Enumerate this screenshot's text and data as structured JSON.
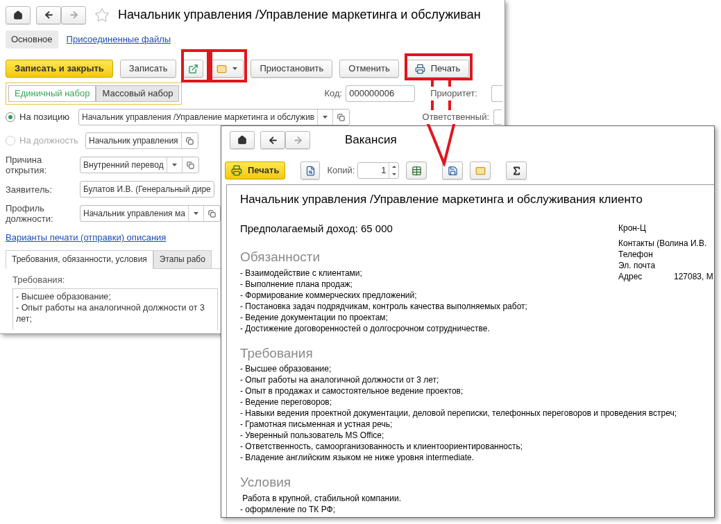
{
  "back_window": {
    "title": "Начальник управления /Управление маркетинга и обслуживан",
    "tabs": [
      {
        "label": "Основное",
        "selected": true
      },
      {
        "label": "Присоединенные файлы",
        "selected": false
      }
    ],
    "toolbar": [
      {
        "kind": "primary",
        "label": "Записать и закрыть"
      },
      {
        "kind": "text",
        "label": "Записать"
      },
      {
        "kind": "external"
      },
      {
        "kind": "mail"
      },
      {
        "kind": "text",
        "label": "Приостановить"
      },
      {
        "kind": "text",
        "label": "Отменить"
      },
      {
        "kind": "print",
        "label": "Печать"
      }
    ],
    "set_modes": [
      {
        "label": "Единичный набор",
        "selected": true
      },
      {
        "label": "Массовый набор",
        "selected": false
      }
    ],
    "code_label": "Код:",
    "code_value": "000000006",
    "priority_label": "Приоритет:",
    "position_modes": [
      {
        "label": "На позицию",
        "selected": true,
        "disabled": false,
        "value": "Начальник управления /Управление маркетинга и обслужив",
        "dropdown": true
      },
      {
        "label": "На должность",
        "selected": false,
        "disabled": true,
        "value": "Начальник управления",
        "dropdown": false
      }
    ],
    "responsible_label": "Ответственный:",
    "fields": [
      {
        "label": "Причина открытия:",
        "value": "Внутренний перевод",
        "dropdown": true
      },
      {
        "label": "Заявитель:",
        "value": "Булатов И.В. (Генеральный дире",
        "dropdown": false
      },
      {
        "label": "Профиль должности:",
        "value": "Начальник управления ма",
        "dropdown": true
      }
    ],
    "print_link": "Варианты печати (отправки) описания",
    "lower_tabs": [
      {
        "label": "Требования, обязанности, условия",
        "selected": true
      },
      {
        "label": "Этапы рабо",
        "selected": false
      }
    ],
    "requirements_label": "Требования:",
    "requirements_lines": [
      "- Высшее образование;",
      "- Опыт работы на аналогичной должности от 3",
      "лет;"
    ]
  },
  "front_window": {
    "title": "Вакансия",
    "toolbar": [
      {
        "kind": "print",
        "label": "Печать"
      },
      {
        "kind": "preview"
      },
      {
        "kind": "copies",
        "label": "Копий:",
        "value": "1"
      },
      {
        "kind": "edit",
        "pressed": true
      },
      {
        "kind": "save"
      },
      {
        "kind": "mail"
      },
      {
        "kind": "sum"
      }
    ],
    "document": {
      "heading": "Начальник управления /Управление маркетинга и обслуживания клиенто",
      "income": "Предполагаемый доход: 65 000",
      "contacts": [
        {
          "label": "Крон-Ц"
        },
        {
          "label": "Контакты (Волина И.В."
        },
        {
          "label": "Телефон"
        },
        {
          "label": "Эл. почта"
        },
        {
          "label": "Адрес",
          "value": "127083, М"
        }
      ],
      "sections": [
        {
          "title": "Обязанности",
          "items": [
            "- Взаимодействие с клиентами;",
            "- Выполнение плана продаж;",
            "- Формирование коммерческих предложений;",
            "- Постановка задач подрядчикам, контроль качества выполняемых работ;",
            "- Ведение документации по проектам;",
            "- Достижение договоренностей о долгосрочном сотрудничестве."
          ]
        },
        {
          "title": "Требования",
          "items": [
            "- Высшее образование;",
            "- Опыт работы на аналогичной должности от 3 лет;",
            "- Опыт в продажах и самостоятельное ведение проектов;",
            "- Ведение переговоров;",
            "- Навыки ведения проектной документации, деловой переписки, телефонных переговоров и проведения встреч;",
            "- Грамотная письменная и устная речь;",
            "- Уверенный пользователь MS Office;",
            "- Ответственность, самоорганизованность и клиентоориентированность;",
            "- Владение английским языком не ниже уровня intermediate."
          ]
        },
        {
          "title": "Условия",
          "items": [
            " Работа в крупной, стабильной компании.",
            "- оформление по ТК РФ;"
          ]
        }
      ]
    }
  }
}
